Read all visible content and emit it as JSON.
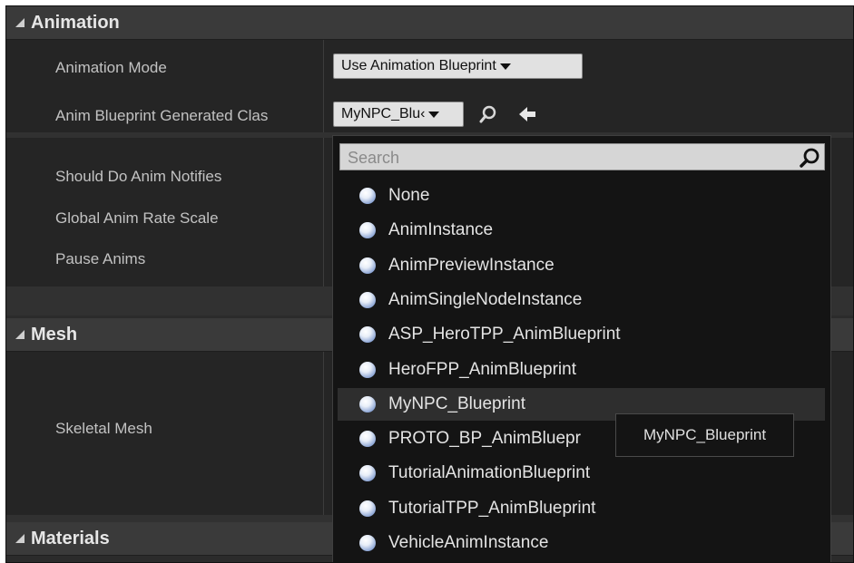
{
  "sections": {
    "animation": {
      "title": "Animation"
    },
    "mesh": {
      "title": "Mesh"
    },
    "materials": {
      "title": "Materials"
    }
  },
  "properties": {
    "animation_mode": {
      "label": "Animation Mode",
      "value": "Use Animation Blueprint"
    },
    "anim_blueprint_class": {
      "label": "Anim Blueprint Generated Clas",
      "value": "MyNPC_Blu‹"
    },
    "should_do_anim_notifies": {
      "label": "Should Do Anim Notifies"
    },
    "global_anim_rate_scale": {
      "label": "Global Anim Rate Scale"
    },
    "pause_anims": {
      "label": "Pause Anims"
    },
    "skeletal_mesh": {
      "label": "Skeletal Mesh"
    }
  },
  "dropdown": {
    "search_placeholder": "Search",
    "options": [
      {
        "label": "None"
      },
      {
        "label": "AnimInstance"
      },
      {
        "label": "AnimPreviewInstance"
      },
      {
        "label": "AnimSingleNodeInstance"
      },
      {
        "label": "ASP_HeroTPP_AnimBlueprint"
      },
      {
        "label": "HeroFPP_AnimBlueprint"
      },
      {
        "label": "MyNPC_Blueprint",
        "selected": true
      },
      {
        "label": "PROTO_BP_AnimBluepr"
      },
      {
        "label": "TutorialAnimationBlueprint"
      },
      {
        "label": "TutorialTPP_AnimBlueprint"
      },
      {
        "label": "VehicleAnimInstance"
      }
    ]
  },
  "tooltip": {
    "text": "MyNPC_Blueprint"
  },
  "colors": {
    "panel": "#2b2b2b",
    "row": "#252525",
    "header": "#3a3a3a",
    "dropdown": "#141414",
    "orb": "#7f9bd0"
  },
  "icons": {
    "find": "magnifier-icon",
    "use_selected": "left-arrow-icon",
    "search": "search-icon",
    "asset": "class-orb-icon"
  }
}
